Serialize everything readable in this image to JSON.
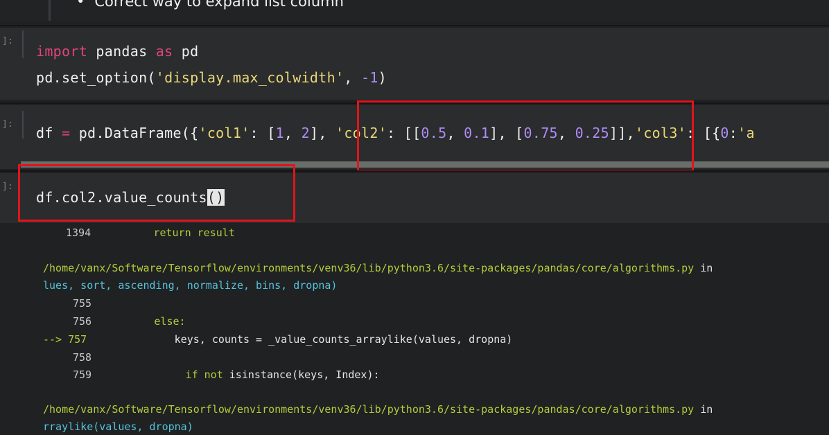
{
  "markdown_bullet": "Correct way to expand list column",
  "prompts": {
    "cell1": "]:",
    "cell2": "]:",
    "cell3": "]:"
  },
  "cell1": {
    "line1": {
      "kw_import": "import",
      "mod": " pandas ",
      "kw_as": "as",
      "alias": " pd"
    },
    "line2": {
      "call": "pd.set_option(",
      "arg": "'display.max_colwidth'",
      "sep": ", ",
      "val": "-1",
      "close": ")"
    }
  },
  "cell2": {
    "pre": "df ",
    "eq": "=",
    "call": " pd.DataFrame({",
    "k1": "'col1'",
    "c1": ": [",
    "v1a": "1",
    "s1": ", ",
    "v1b": "2",
    "e1": "], ",
    "k2": "'col2'",
    "c2": ": [[",
    "v2a": "0.5",
    "s2": ", ",
    "v2b": "0.1",
    "m2": "], [",
    "v2c": "0.75",
    "s3": ", ",
    "v2d": "0.25",
    "e2": "]],",
    "k3": "'col3'",
    "c3": ": [{",
    "v3": "0",
    "c4": ":",
    "k4": "'a"
  },
  "cell3": {
    "code": "df.col2.value_counts",
    "paren": "()"
  },
  "traceback": {
    "l1_num": "1394",
    "l1_code": "return result",
    "path1": "/home/vanx/Software/Tensorflow/environments/venv36/lib/python3.6/site-packages/pandas/core/algorithms.py",
    "in1": " in",
    "sig1": "lues, sort, ascending, normalize, bins, dropna)",
    "l755": "755",
    "l756": "756",
    "else": "else:",
    "arrow": "-->",
    "l757": "757",
    "code757": "keys, counts = _value_counts_arraylike(values, dropna)",
    "l758": "758",
    "l759": "759",
    "if": "if",
    "not": " not",
    "code759": " isinstance(keys, Index):",
    "path2": "/home/vanx/Software/Tensorflow/environments/venv36/lib/python3.6/site-packages/pandas/core/algorithms.py",
    "in2": " in",
    "sig2": "rraylike(values, dropna)"
  },
  "colors": {
    "highlight_box": "#e0151b",
    "keyword": "#e0457a",
    "string": "#ebd776",
    "number": "#b08cf4",
    "path": "#b8cc3a",
    "signature": "#56c3dd"
  }
}
